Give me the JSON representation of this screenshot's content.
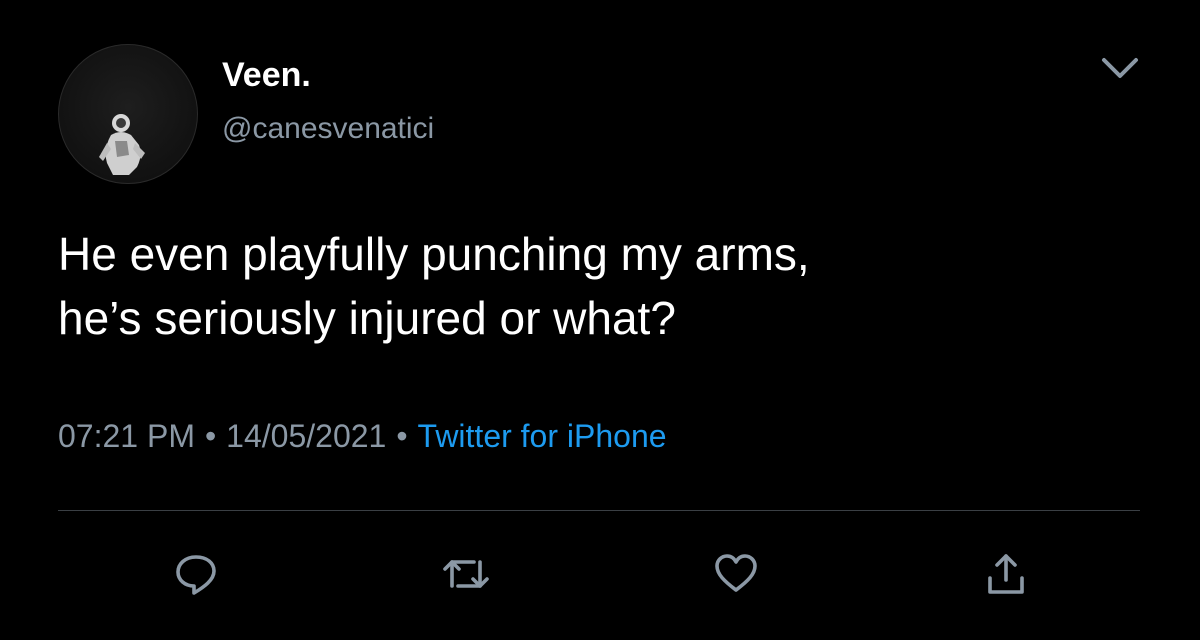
{
  "user": {
    "display_name": "Veen.",
    "handle": "@canesvenatici"
  },
  "tweet": {
    "text_lines": [
      "He even playfully punching my arms,",
      "he’s seriously injured or what?"
    ],
    "time": "07:21 PM",
    "date": "14/05/2021",
    "separator": "•",
    "source": "Twitter for iPhone"
  },
  "icons": {
    "menu": "chevron-down-icon",
    "reply": "reply-icon",
    "retweet": "retweet-icon",
    "like": "heart-icon",
    "share": "share-icon"
  },
  "colors": {
    "background": "#000000",
    "text": "#ffffff",
    "secondary": "#8b98a5",
    "link": "#1d9bf0",
    "divider": "#3a3f44"
  }
}
